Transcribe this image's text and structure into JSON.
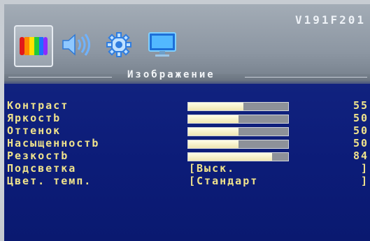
{
  "model": "V191F201",
  "section_title": "Изображение",
  "tabs": [
    {
      "icon": "color-bars-icon",
      "selected": true
    },
    {
      "icon": "speaker-icon",
      "selected": false
    },
    {
      "icon": "gear-icon",
      "selected": false
    },
    {
      "icon": "monitor-icon",
      "selected": false
    }
  ],
  "settings": [
    {
      "label": "Контраст",
      "value": "55",
      "level": 0.55
    },
    {
      "label": "Яркостb",
      "value": "50",
      "level": 0.5
    },
    {
      "label": "Оттенок",
      "value": "50",
      "level": 0.5
    },
    {
      "label": "Насыщенностb",
      "value": "50",
      "level": 0.5
    },
    {
      "label": "Резкостb",
      "value": "84",
      "level": 0.84
    }
  ],
  "options": [
    {
      "label": "Подсветка",
      "open": "[",
      "value": "Выск.",
      "close": "]"
    },
    {
      "label": "Цвет. темп.",
      "open": "[",
      "value": "Стандарт",
      "close": "]"
    }
  ],
  "colors": {
    "label_text": "#f0e38c",
    "panel_bg": "#0c1c78",
    "bar_fill": "#fffde6",
    "bar_track": "#8d9199"
  }
}
